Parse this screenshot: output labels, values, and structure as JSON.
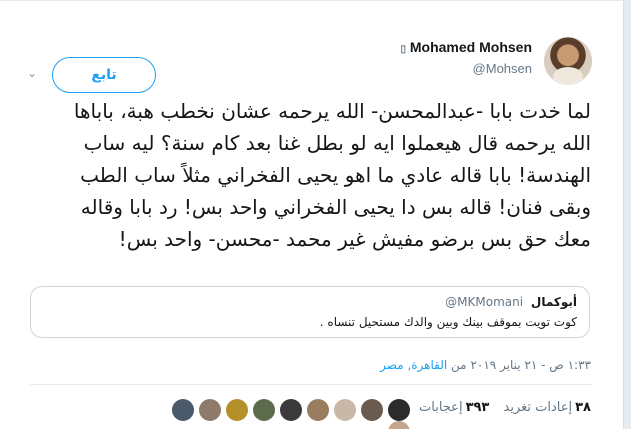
{
  "author": {
    "name": "Mohamed Mohsen",
    "verified_glyph": "▯",
    "handle": "@Mohsen"
  },
  "follow_button_label": "تابع",
  "menu_icon": "chevron-down-icon",
  "tweet": {
    "lines": [
      "لما خدت بابا -عبدالمحسن- الله يرحمه عشان نخطب هبة، باباها",
      "الله يرحمه قال هيعملوا ايه لو بطل غنا بعد كام سنة؟ ليه ساب",
      "الهندسة! بابا قاله عادي ما اهو يحيى الفخراني مثلاً ساب الطب",
      "وبقى فنان! قاله بس دا يحيى الفخراني واحد بس! رد بابا وقاله",
      "معك حق بس برضو مفيش غير محمد -محسن- واحد بس!"
    ]
  },
  "quoted": {
    "name": "أبوكمال",
    "handle": "@MKMomani",
    "text": "كوت تويت بموقف بينك وبين والدك مستحيل تنساه ."
  },
  "meta": {
    "time_date": "١:٣٣ ص - ٢١ يناير ٢٠١٩ من",
    "location": "القاهرة, مصر"
  },
  "stats": {
    "retweets_count": "٣٨",
    "retweets_label": "إعادات تغريد",
    "likes_count": "٣٩٣",
    "likes_label": "إعجابات"
  },
  "colors": {
    "accent": "#1da1f2",
    "secondary_text": "#657786",
    "border": "#ccd6dd",
    "likers": [
      "#2b2b2b",
      "#6b5a4e",
      "#c9b8a8",
      "#9a7d5e",
      "#3a3a3a",
      "#5c6b4c",
      "#b58f2a",
      "#8d7a6a",
      "#4a5a6a",
      "#c7a58a",
      "#7a6a8a",
      "#5a6a7a"
    ]
  }
}
